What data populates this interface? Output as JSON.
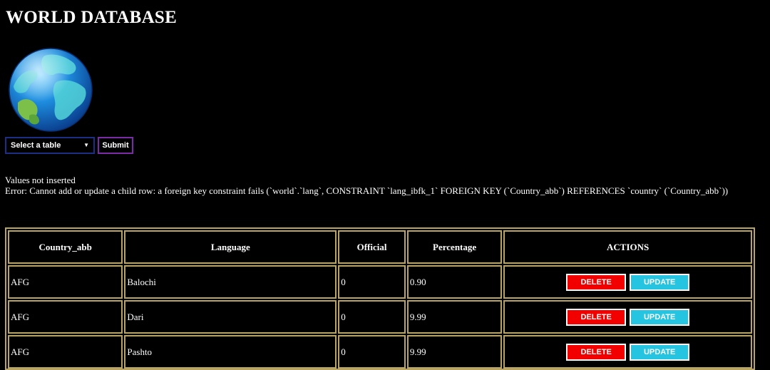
{
  "header": {
    "title": "WORLD DATABASE"
  },
  "form": {
    "select_label": "Select a table",
    "select_arrow": "▼",
    "submit_label": "Submit"
  },
  "messages": {
    "status": "Values not inserted",
    "error": "Error: Cannot add or update a child row: a foreign key constraint fails (`world`.`lang`, CONSTRAINT `lang_ibfk_1` FOREIGN KEY (`Country_abb`) REFERENCES `country` (`Country_abb`))"
  },
  "table": {
    "headers": [
      "Country_abb",
      "Language",
      "Official",
      "Percentage",
      "ACTIONS"
    ],
    "rows": [
      {
        "country_abb": "AFG",
        "language": "Balochi",
        "official": "0",
        "percentage": "0.90"
      },
      {
        "country_abb": "AFG",
        "language": "Dari",
        "official": "0",
        "percentage": "9.99"
      },
      {
        "country_abb": "AFG",
        "language": "Pashto",
        "official": "0",
        "percentage": "9.99"
      }
    ],
    "delete_label": "DELETE",
    "update_label": "UPDATE"
  },
  "colors": {
    "background": "#000000",
    "table_border": "#b9a462",
    "delete_button": "#f20000",
    "update_button": "#25c4e0"
  },
  "icons": {
    "logo": "globe-icon"
  }
}
